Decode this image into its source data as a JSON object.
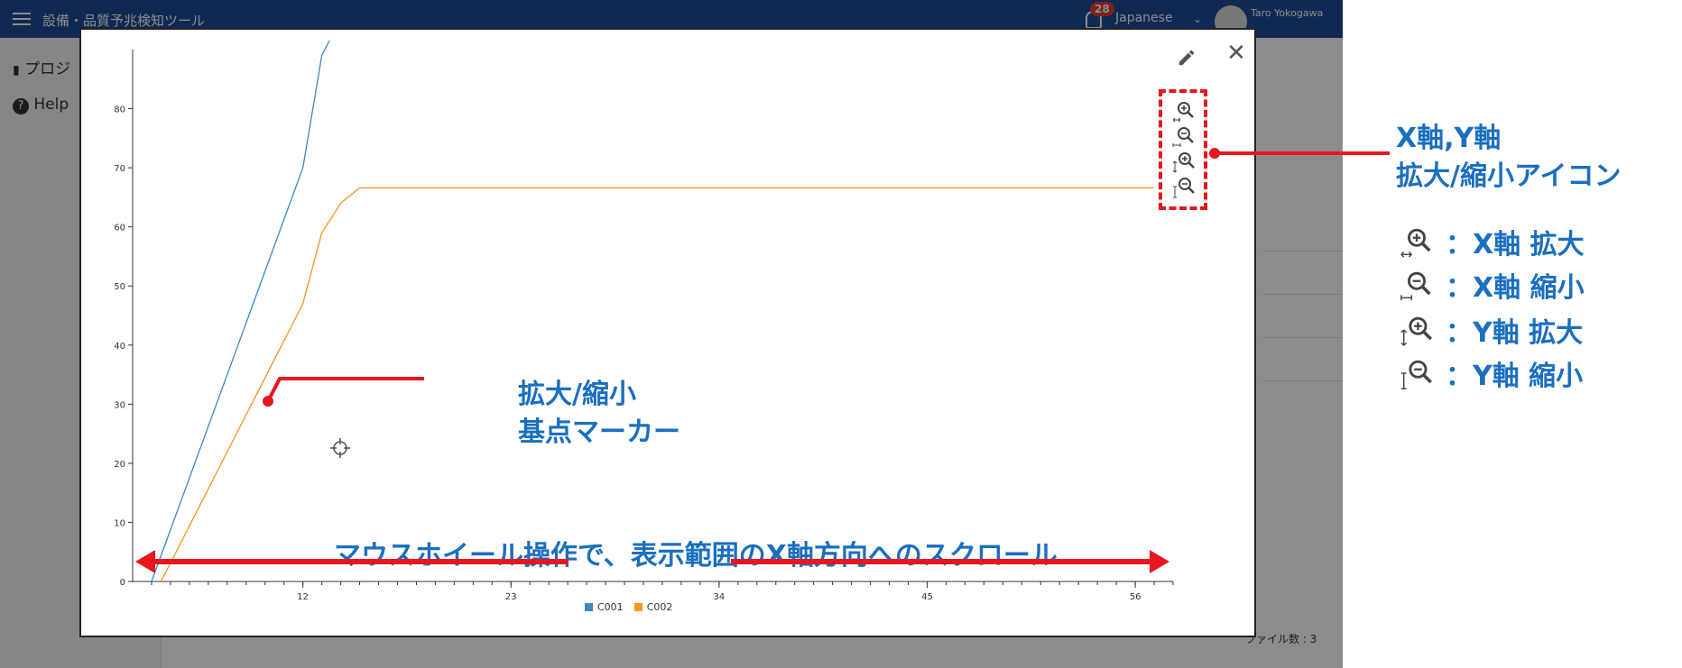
{
  "app": {
    "title": "設備・品質予兆検知ツール",
    "notification_count": "28",
    "language": "Japanese",
    "user_name": "Taro Yokogawa",
    "sidebar_items": [
      "プロジ",
      "Help"
    ],
    "file_count_label": "ファイル数 : 3"
  },
  "modal": {
    "icons": [
      "edit-icon",
      "close-icon",
      "zoom-in-x-icon",
      "zoom-out-x-icon",
      "zoom-in-y-icon",
      "zoom-out-y-icon",
      "crosshair-icon"
    ],
    "colors": {
      "series1": "#3a87c8",
      "series2": "#f7941d",
      "annotation": "#1a6fc0",
      "highlight": "#e8161e"
    }
  },
  "chart_data": {
    "type": "line",
    "x_ticks": [
      12,
      23,
      34,
      45,
      56
    ],
    "y_ticks": [
      0,
      10,
      20,
      30,
      40,
      50,
      60,
      70,
      80
    ],
    "xlim": [
      3,
      58
    ],
    "ylim": [
      0,
      90
    ],
    "series": [
      {
        "name": "C001",
        "x": [
          4,
          12,
          13,
          13.4
        ],
        "y": [
          0,
          70,
          89,
          92
        ]
      },
      {
        "name": "C002",
        "x": [
          4.5,
          12,
          13,
          14,
          15,
          57
        ],
        "y": [
          0,
          47,
          59,
          64,
          66.6,
          66.6
        ]
      }
    ]
  },
  "annotations": {
    "marker_label_line1": "拡大/縮小",
    "marker_label_line2": "基点マーカー",
    "scroll_label": "マウスホイール操作で、表示範囲のX軸方向へのスクロール",
    "zoom_title_line1": "X軸,Y軸",
    "zoom_title_line2": "拡大/縮小アイコン",
    "zoom_legend": [
      {
        "icon": "zoom-in-x-icon",
        "label": "：X軸 拡大"
      },
      {
        "icon": "zoom-out-x-icon",
        "label": "：X軸 縮小"
      },
      {
        "icon": "zoom-in-y-icon",
        "label": "：Y軸 拡大"
      },
      {
        "icon": "zoom-out-y-icon",
        "label": "：Y軸 縮小"
      }
    ]
  }
}
